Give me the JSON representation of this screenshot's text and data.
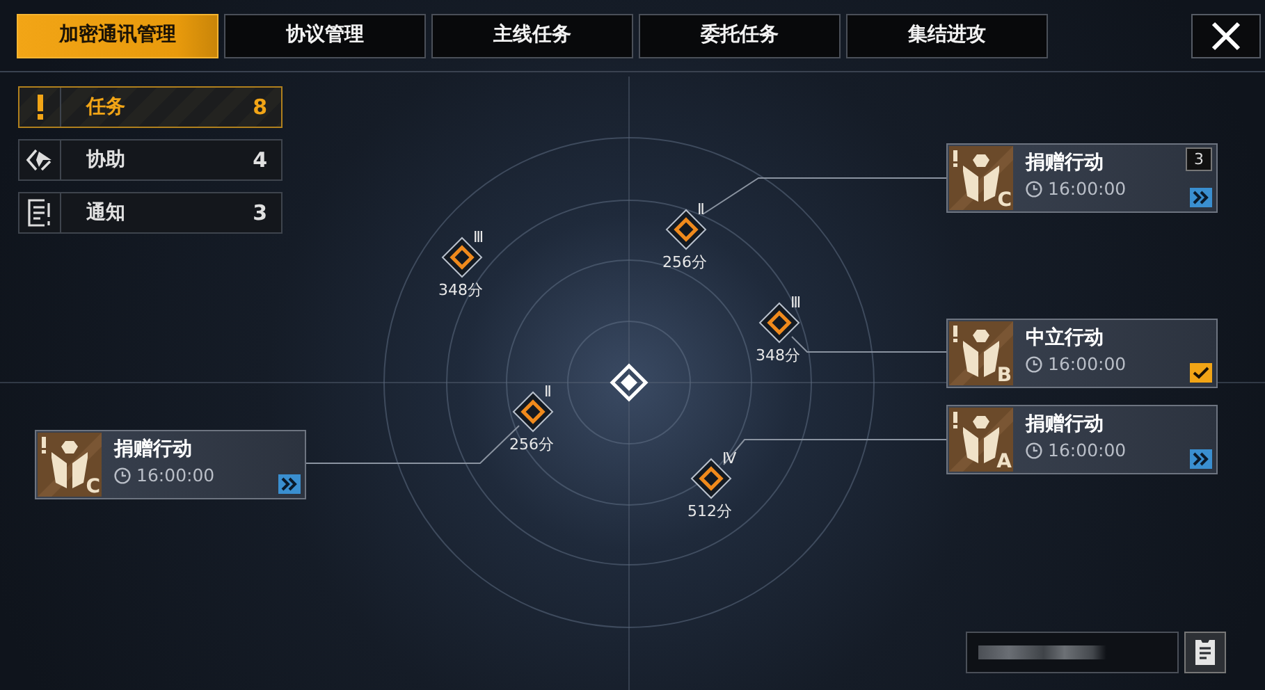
{
  "tabs": [
    {
      "label": "加密通讯管理",
      "selected": true
    },
    {
      "label": "协议管理",
      "selected": false
    },
    {
      "label": "主线任务",
      "selected": false
    },
    {
      "label": "委托任务",
      "selected": false
    },
    {
      "label": "集结进攻",
      "selected": false
    }
  ],
  "categories": [
    {
      "kind": "task",
      "label": "任务",
      "count": "8",
      "selected": true
    },
    {
      "kind": "assist",
      "label": "协助",
      "count": "4",
      "selected": false
    },
    {
      "kind": "notice",
      "label": "通知",
      "count": "3",
      "selected": false
    }
  ],
  "nodes": [
    {
      "rank": "Ⅲ",
      "score": "348分"
    },
    {
      "rank": "Ⅱ",
      "score": "256分"
    },
    {
      "rank": "Ⅲ",
      "score": "348分"
    },
    {
      "rank": "Ⅱ",
      "score": "256分"
    },
    {
      "rank": "Ⅳ",
      "score": "512分"
    }
  ],
  "missions": [
    {
      "title": "捐赠行动",
      "grade": "C",
      "time": "16:00:00",
      "count": "3",
      "alert": true,
      "completed": false
    },
    {
      "title": "中立行动",
      "grade": "B",
      "time": "16:00:00",
      "alert": true,
      "completed": true
    },
    {
      "title": "捐赠行动",
      "grade": "A",
      "time": "16:00:00",
      "alert": true,
      "completed": false
    },
    {
      "title": "捐赠行动",
      "grade": "C",
      "time": "16:00:00",
      "alert": true,
      "completed": false
    }
  ]
}
